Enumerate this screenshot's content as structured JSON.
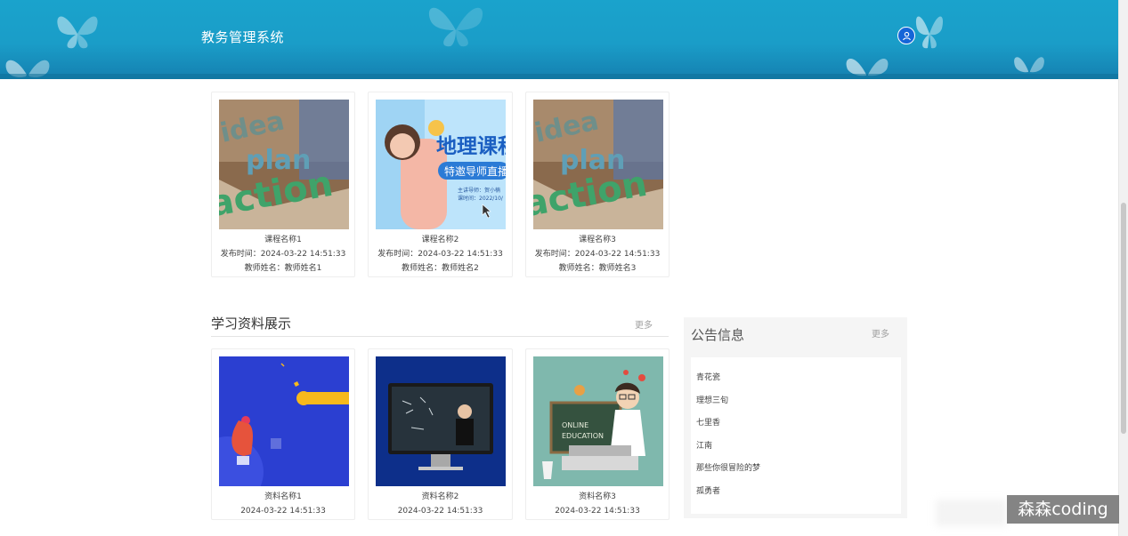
{
  "header": {
    "site_title": "教务管理系统",
    "avatar_icon": "user-icon"
  },
  "courses": {
    "items": [
      {
        "name": "课程名称1",
        "publish": "发布时间：2024-03-22 14:51:33",
        "teacher": "教师姓名：教师姓名1"
      },
      {
        "name": "课程名称2",
        "publish": "发布时间：2024-03-22 14:51:33",
        "teacher": "教师姓名：教师姓名2"
      },
      {
        "name": "课程名称3",
        "publish": "发布时间：2024-03-22 14:51:33",
        "teacher": "教师姓名：教师姓名3"
      }
    ],
    "poster2": {
      "title": "地理课程",
      "subtitle": "特邀导师直播",
      "line1": "主讲导师：贺小楠",
      "line2": "课时间：2022/10/"
    },
    "poster_words": {
      "w1": "idea",
      "w2": "plan",
      "w3": "action"
    }
  },
  "materials": {
    "title": "学习资料展示",
    "more": "更多",
    "items": [
      {
        "name": "资料名称1",
        "date": "2024-03-22 14:51:33"
      },
      {
        "name": "资料名称2",
        "date": "2024-03-22 14:51:33"
      },
      {
        "name": "资料名称3",
        "date": "2024-03-22 14:51:33"
      }
    ],
    "poster3": {
      "line1": "ONLINE",
      "line2": "EDUCATION"
    }
  },
  "notice": {
    "title": "公告信息",
    "more": "更多",
    "items": [
      "青花瓷",
      "理想三旬",
      "七里香",
      "江南",
      "那些你很冒险的梦",
      "孤勇者"
    ]
  },
  "watermark": "森森coding",
  "colors": {
    "header": "#1aa3cc",
    "avatar": "#1565d8",
    "card_border": "#eeeeee",
    "muted": "#a0a0a0"
  }
}
